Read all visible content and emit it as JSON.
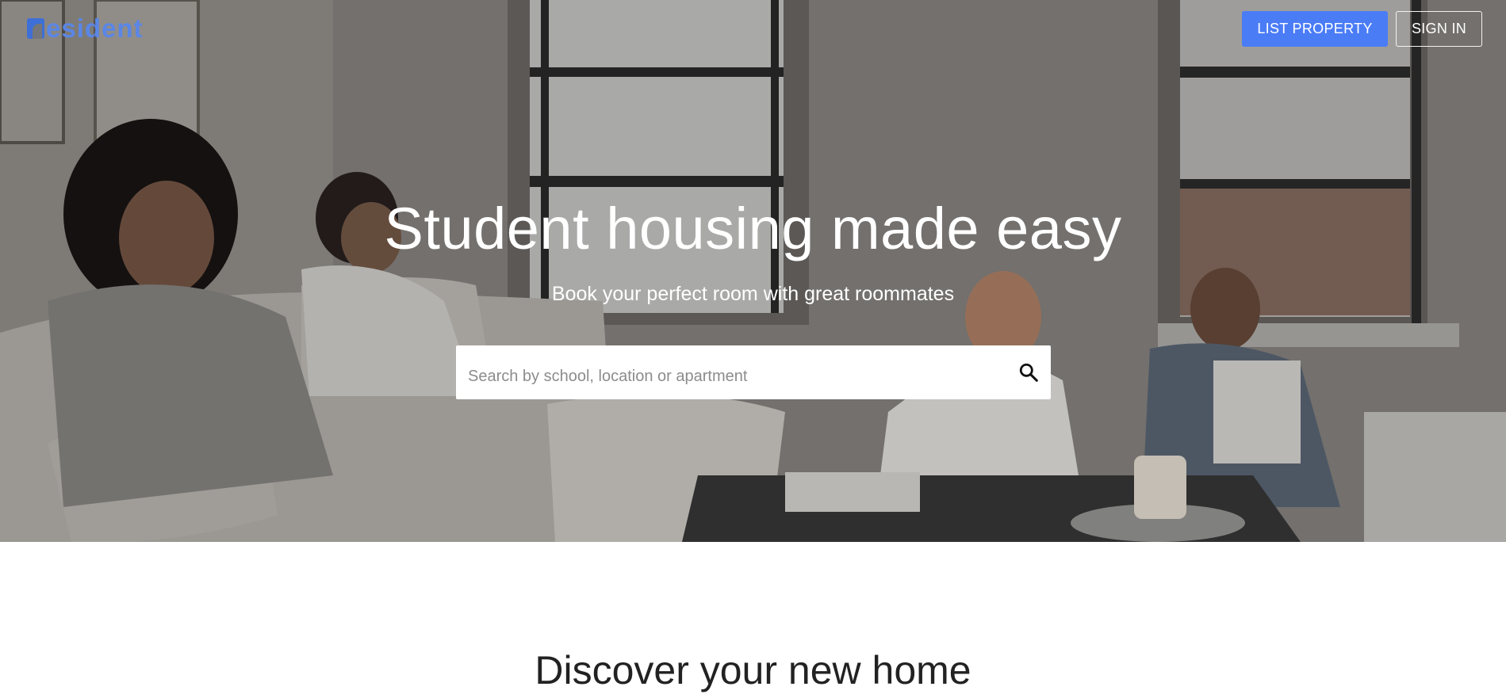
{
  "brand": {
    "logo_text": "esident",
    "accent_color": "#4a7cf6"
  },
  "header": {
    "list_property_label": "LIST PROPERTY",
    "sign_in_label": "SIGN IN"
  },
  "hero": {
    "title": "Student housing made easy",
    "subtitle": "Book your perfect room with great roommates",
    "background_image": "living-room-with-students"
  },
  "search": {
    "placeholder": "Search by school, location or apartment",
    "value": "",
    "icon": "search-icon"
  },
  "main": {
    "section_title": "Discover your new home"
  }
}
